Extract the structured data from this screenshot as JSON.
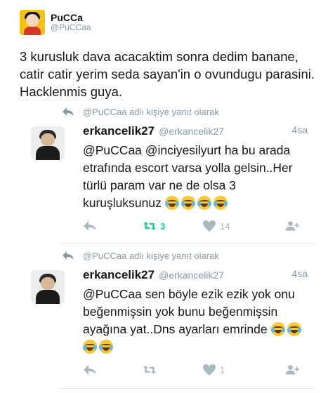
{
  "main_tweet": {
    "display_name": "PuCCa",
    "handle": "@PuCCaa",
    "text": "3 kurusluk dava acacaktim sonra dedim banane, catir catir yerim seda sayan'in o ovundugu parasini. Hacklenmis guya."
  },
  "replies": [
    {
      "context": "@PuCCaa adlı kişiye yanıt olarak",
      "name": "erkancelik27",
      "handle": "@erkancelik27",
      "time": "4sa",
      "text": "@PuCCaa @inciyesilyurt ha bu arada etrafında escort varsa yolla gelsin..Her türlü param var ne de olsa 3 kuruşluksunuz",
      "emoji_count": 4,
      "retweets": "3",
      "likes": "14",
      "retweet_active": true
    },
    {
      "context": "@PuCCaa adlı kişiye yanıt olarak",
      "name": "erkancelik27",
      "handle": "@erkancelik27",
      "time": "4sa",
      "text": "@PuCCaa sen böyle ezik ezik yok onu beğenmişsin yok bunu beğenmişsin ayağına yat..Dns ayarları emrinde",
      "emoji_count": 4,
      "retweets": "",
      "likes": "1",
      "retweet_active": false
    }
  ],
  "icons": {
    "reply": "reply-arrow-icon",
    "retweet": "retweet-icon",
    "like": "heart-icon",
    "follow": "add-user-icon",
    "emoji": "face-with-tears-of-joy-icon"
  },
  "colors": {
    "text": "#14171a",
    "muted": "#8899a6",
    "action": "#aab8c2",
    "retweet_active": "#19cf86"
  }
}
